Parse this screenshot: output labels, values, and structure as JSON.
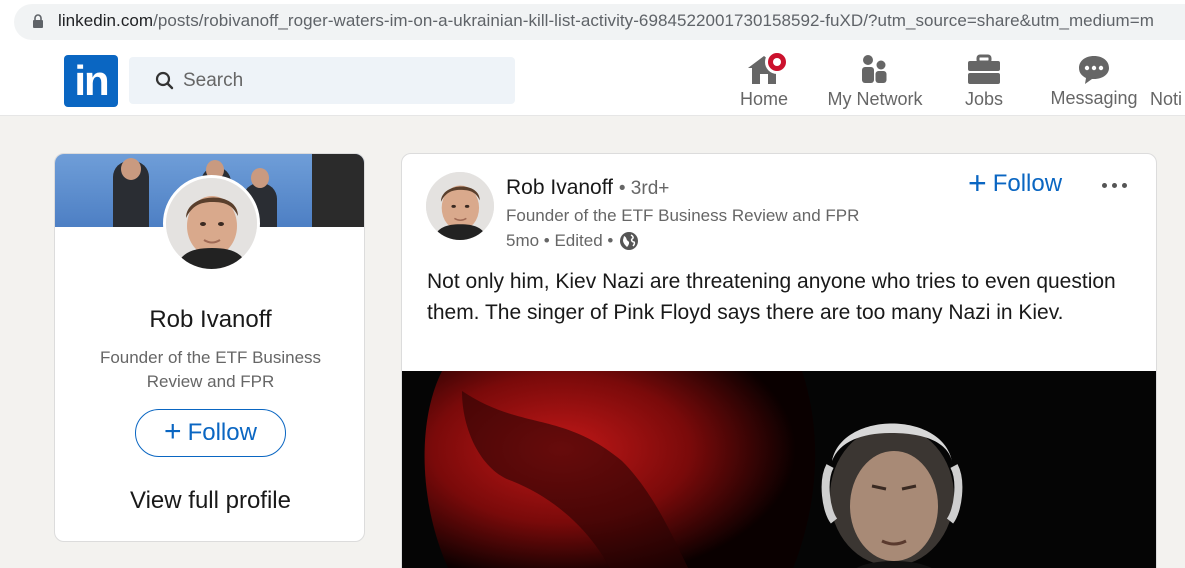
{
  "browser": {
    "url_host": "linkedin.com",
    "url_path": "/posts/robivanoff_roger-waters-im-on-a-ukrainian-kill-list-activity-6984522001730158592-fuXD/?utm_source=share&utm_medium=m"
  },
  "nav": {
    "search_placeholder": "Search",
    "items": [
      {
        "label": "Home",
        "icon": "home-icon",
        "notification_badge": true
      },
      {
        "label": "My Network",
        "icon": "network-icon"
      },
      {
        "label": "Jobs",
        "icon": "briefcase-icon"
      },
      {
        "label": "Messaging",
        "icon": "messaging-icon"
      },
      {
        "label": "Noti",
        "icon": "bell-icon"
      }
    ]
  },
  "colors": {
    "brand": "#0a66c2",
    "badge": "#cb112d",
    "background": "#f3f2ef"
  },
  "profile": {
    "name": "Rob Ivanoff",
    "headline": "Founder of the ETF Business Review and FPR",
    "follow_label": "Follow",
    "view_profile_label": "View full profile"
  },
  "post": {
    "author": "Rob Ivanoff",
    "degree": "• 3rd+",
    "headline": "Founder of the ETF Business Review and FPR",
    "meta": "5mo • Edited •",
    "follow_label": "Follow",
    "text": "Not only him, Kiev Nazi are threatening anyone who tries to even question them. The singer of Pink Floyd says there are too many Nazi in Kiev."
  }
}
